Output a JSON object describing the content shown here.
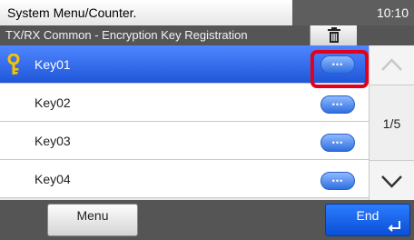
{
  "topbar": {
    "menu_path": "System Menu/Counter.",
    "time": "10:10"
  },
  "header": {
    "title": "TX/RX Common - Encryption Key Registration",
    "delete_icon": "trash-icon"
  },
  "list": {
    "items": [
      {
        "label": "Key01",
        "selected": true,
        "icon": "key-icon"
      },
      {
        "label": "Key02",
        "selected": false
      },
      {
        "label": "Key03",
        "selected": false
      },
      {
        "label": "Key04",
        "selected": false
      }
    ],
    "detail_button_icon": "ellipsis-icon"
  },
  "pager": {
    "indicator": "1/5",
    "up_icon": "chevron-up-icon",
    "down_icon": "chevron-down-icon"
  },
  "footer": {
    "menu_label": "Menu",
    "end_label": "End",
    "end_icon": "enter-icon"
  },
  "colors": {
    "selected_row": "#2f6ae8",
    "highlight": "#e3001b",
    "end_button": "#1461ea"
  }
}
